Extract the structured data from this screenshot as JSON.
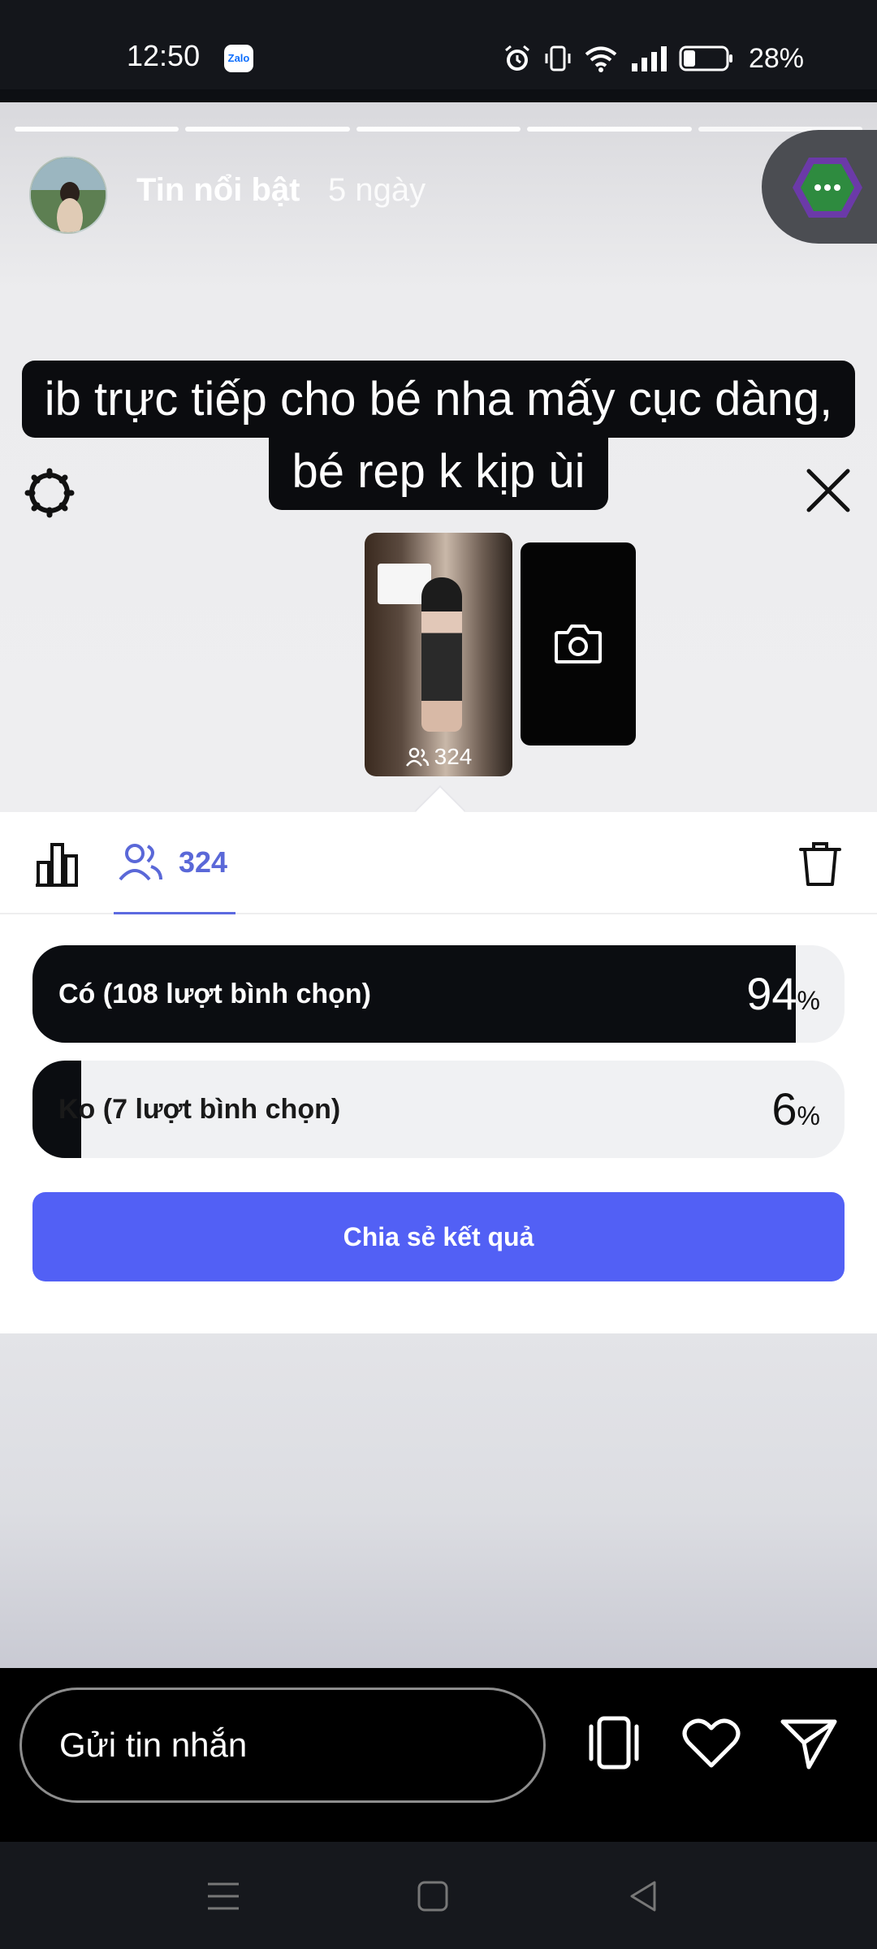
{
  "status_bar": {
    "time": "12:50",
    "notification_app": "Zalo",
    "battery_percent": "28%",
    "battery_level": 0.28,
    "icons": [
      "alarm-icon",
      "vibrate-icon",
      "wifi-icon",
      "signal-icon",
      "battery-icon"
    ]
  },
  "story": {
    "progress_segments": 5,
    "title": "Tin nổi bật",
    "age": "5 ngày",
    "caption_line1": "ib trực tiếp cho bé nha mấy cục dàng,",
    "caption_line2": "bé rep k kịp ùi",
    "thumbnail_viewers": "324"
  },
  "results": {
    "voters_count": "324",
    "options": [
      {
        "label": "Có (108 lượt bình chọn)",
        "percent": "94",
        "percent_value": 94
      },
      {
        "label": "Ko (7 lượt bình chọn)",
        "percent": "6",
        "percent_value": 6
      }
    ],
    "percent_sign": "%",
    "share_button": "Chia sẻ kết quả"
  },
  "message_bar": {
    "placeholder": "Gửi tin nhắn"
  },
  "colors": {
    "accent": "#5260f5",
    "tab_accent": "#5a68d8",
    "poll_fill": "#0b0d11",
    "poll_track": "#f0f1f3"
  }
}
